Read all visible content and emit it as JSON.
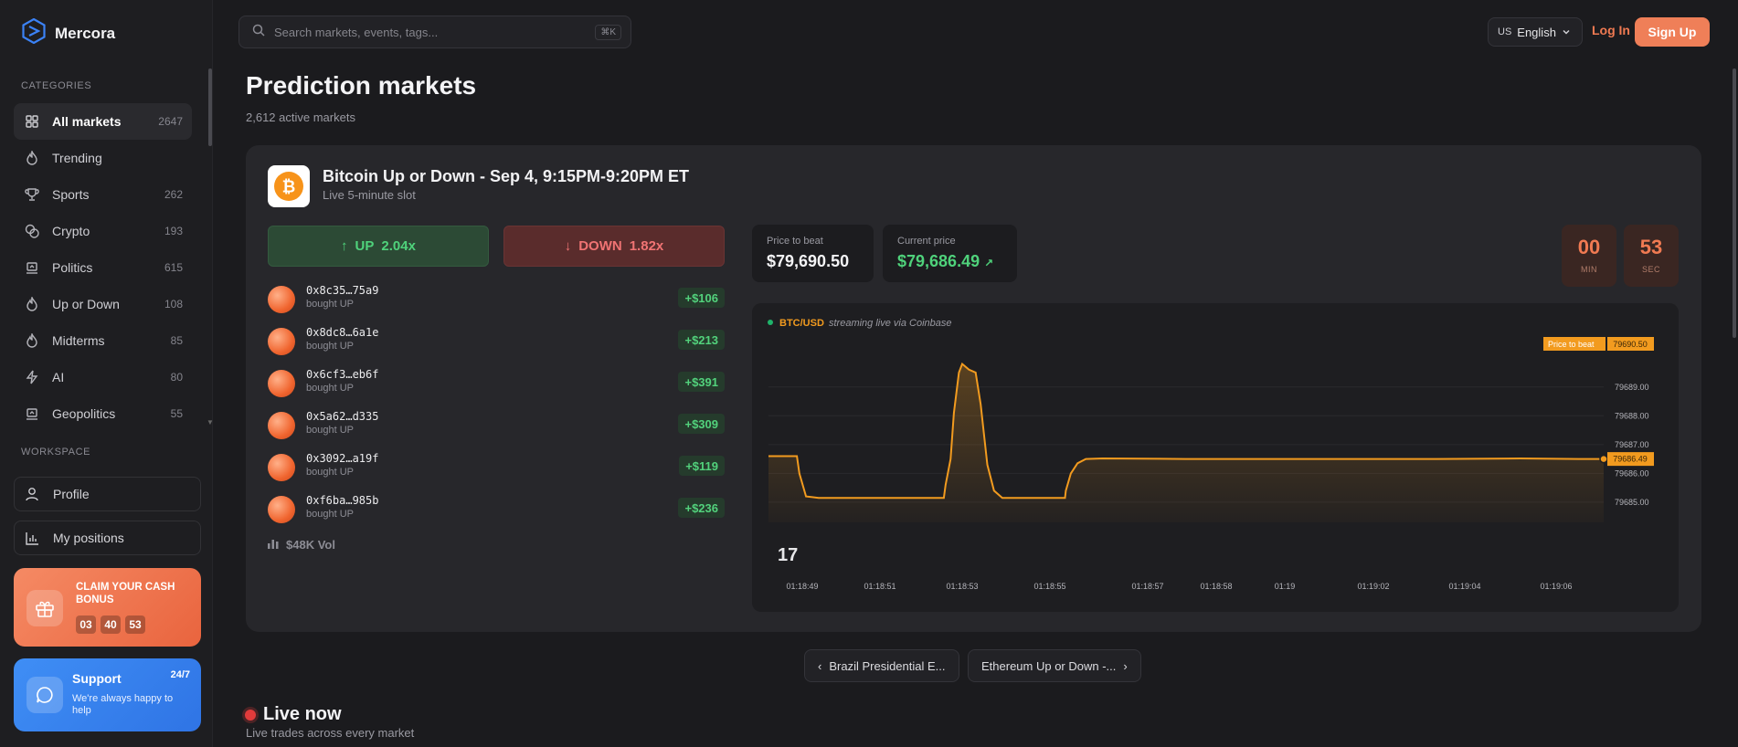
{
  "app": {
    "name": "Mercora"
  },
  "sidebar": {
    "categories_label": "CATEGORIES",
    "categories": [
      {
        "label": "All markets",
        "count": "2647",
        "icon": "grid-icon",
        "active": true
      },
      {
        "label": "Trending",
        "count": "",
        "icon": "flame-icon"
      },
      {
        "label": "Sports",
        "count": "262",
        "icon": "trophy-icon"
      },
      {
        "label": "Crypto",
        "count": "193",
        "icon": "coins-icon"
      },
      {
        "label": "Politics",
        "count": "615",
        "icon": "podium-icon"
      },
      {
        "label": "Up or Down",
        "count": "108",
        "icon": "flame-icon"
      },
      {
        "label": "Midterms",
        "count": "85",
        "icon": "flame-icon"
      },
      {
        "label": "AI",
        "count": "80",
        "icon": "bolt-icon"
      },
      {
        "label": "Geopolitics",
        "count": "55",
        "icon": "podium-icon"
      }
    ],
    "workspace_label": "WORKSPACE",
    "workspace": [
      {
        "label": "Profile",
        "icon": "user-icon"
      },
      {
        "label": "My positions",
        "icon": "bar-chart-icon"
      }
    ],
    "bonus": {
      "title": "CLAIM YOUR CASH BONUS",
      "timer": [
        "03",
        "40",
        "53"
      ],
      "color": "#ef7f58"
    },
    "support": {
      "title": "Support",
      "badge": "24/7",
      "subtitle": "We're always happy to help",
      "color": "#3a86f0"
    }
  },
  "topbar": {
    "search_placeholder": "Search markets, events, tags...",
    "search_shortcut": "⌘K",
    "lang_flag": "US",
    "lang_label": "English",
    "login": "Log In",
    "signup": "Sign Up"
  },
  "page": {
    "title": "Prediction markets",
    "subtitle": "2,612 active markets"
  },
  "market": {
    "title": "Bitcoin Up or Down - Sep 4, 9:15PM-9:20PM ET",
    "subtitle": "Live 5-minute slot",
    "up": {
      "label": "UP",
      "odds": "2.04x"
    },
    "down": {
      "label": "DOWN",
      "odds": "1.82x"
    },
    "trades": [
      {
        "address": "0x8c35…75a9",
        "action": "bought UP",
        "amount": "+$106"
      },
      {
        "address": "0x8dc8…6a1e",
        "action": "bought UP",
        "amount": "+$213"
      },
      {
        "address": "0x6cf3…eb6f",
        "action": "bought UP",
        "amount": "+$391"
      },
      {
        "address": "0x5a62…d335",
        "action": "bought UP",
        "amount": "+$309"
      },
      {
        "address": "0x3092…a19f",
        "action": "bought UP",
        "amount": "+$119"
      },
      {
        "address": "0xf6ba…985b",
        "action": "bought UP",
        "amount": "+$236"
      }
    ],
    "volume": "$48K Vol",
    "price_to_beat_label": "Price to beat",
    "price_to_beat": "$79,690.50",
    "current_price_label": "Current price",
    "current_price": "$79,686.49",
    "timer": {
      "minutes": "00",
      "min_label": "MIN",
      "seconds": "53",
      "sec_label": "SEC"
    }
  },
  "chart_data": {
    "type": "line",
    "pair": "BTC/USD",
    "source_note": "streaming live via Coinbase",
    "price_to_beat_tag": "Price to beat",
    "price_to_beat_value": "79690.50",
    "current_value_tag": "79686.49",
    "y_ticks": [
      "79689.00",
      "79688.00",
      "79687.00",
      "79686.00",
      "79685.00"
    ],
    "x_ticks": [
      "01:18:49",
      "01:18:51",
      "01:18:53",
      "01:18:55",
      "01:18:57",
      "01:18:58",
      "01:19",
      "01:19:02",
      "01:19:04",
      "01:19:06"
    ],
    "ylim": [
      79684.3,
      79690.8
    ],
    "x": [
      0,
      0.034,
      0.037,
      0.045,
      0.06,
      0.12,
      0.21,
      0.212,
      0.218,
      0.222,
      0.228,
      0.232,
      0.24,
      0.248,
      0.254,
      0.262,
      0.27,
      0.28,
      0.3,
      0.335,
      0.355,
      0.356,
      0.362,
      0.37,
      0.38,
      0.4,
      0.5,
      0.6,
      0.7,
      0.8,
      0.9,
      0.97,
      1.0
    ],
    "y": [
      79686.6,
      79686.6,
      79686.0,
      79685.2,
      79685.15,
      79685.15,
      79685.15,
      79685.6,
      79686.5,
      79688.1,
      79689.5,
      79689.8,
      79689.6,
      79689.5,
      79688.4,
      79686.3,
      79685.4,
      79685.15,
      79685.15,
      79685.15,
      79685.15,
      79685.4,
      79686.0,
      79686.35,
      79686.5,
      79686.52,
      79686.5,
      79686.5,
      79686.5,
      79686.5,
      79686.52,
      79686.5,
      79686.5
    ],
    "line_color": "#f29b1f"
  },
  "pager": {
    "prev": "Brazil Presidential E...",
    "next": "Ethereum Up or Down -..."
  },
  "live": {
    "title": "Live now",
    "subtitle": "Live trades across every market"
  }
}
